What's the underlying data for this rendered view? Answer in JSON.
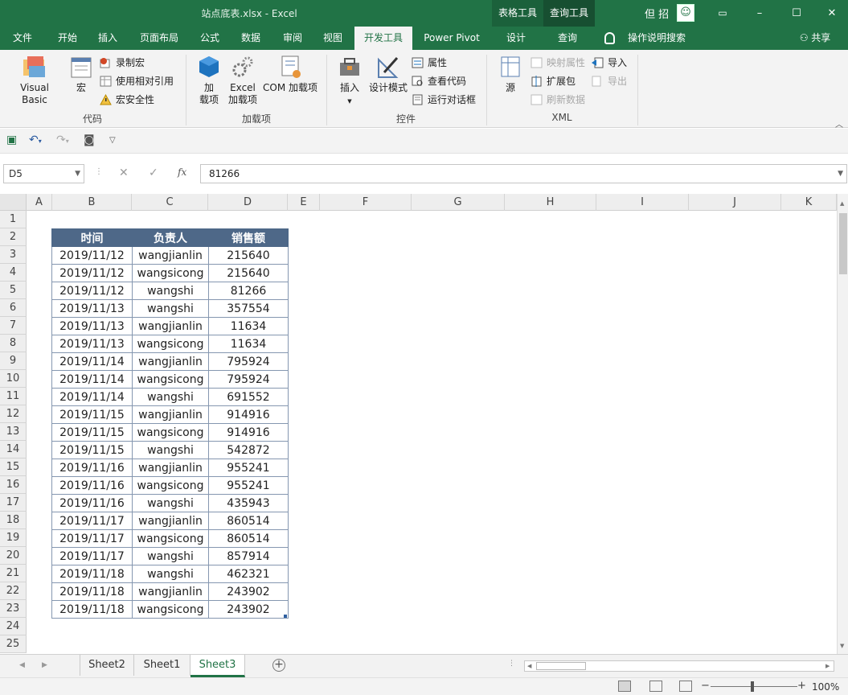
{
  "titlebar": {
    "title": "站点底表.xlsx - Excel",
    "context_tab_1": "表格工具",
    "context_tab_2": "查询工具",
    "user": "但 招",
    "avatar_icon": "user-avatar-icon",
    "ribbon_display_icon": "ribbon-display-options-icon",
    "minimize": "–",
    "maximize": "☐",
    "close": "✕"
  },
  "ribbon_tabs": [
    "文件",
    "开始",
    "插入",
    "页面布局",
    "公式",
    "数据",
    "审阅",
    "视图",
    "开发工具",
    "Power Pivot",
    "设计",
    "查询"
  ],
  "active_tab": "开发工具",
  "tell_me": "操作说明搜索",
  "share": "共享",
  "ribbon": {
    "code": {
      "label": "代码",
      "visual_basic": "Visual Basic",
      "macros": "宏",
      "record_macro": "录制宏",
      "relative_ref": "使用相对引用",
      "macro_security": "宏安全性"
    },
    "addins": {
      "label": "加载项",
      "addins_1": "加",
      "addins_2": "载项",
      "excel_addins_1": "Excel",
      "excel_addins_2": "加载项",
      "com_addins": "COM 加载项"
    },
    "controls": {
      "label": "控件",
      "insert": "插入",
      "design_mode": "设计模式",
      "properties": "属性",
      "view_code": "查看代码",
      "run_dialog": "运行对话框"
    },
    "xml": {
      "label": "XML",
      "source": "源",
      "map_props": "映射属性",
      "expansion_packs": "扩展包",
      "refresh_data": "刷新数据",
      "import": "导入",
      "export": "导出"
    }
  },
  "quick_access": {
    "save_icon": "save-icon",
    "undo_icon": "undo-icon",
    "redo_icon": "redo-icon",
    "camera_icon": "camera-icon",
    "customize_icon": "customize-qat-icon"
  },
  "formula_bar": {
    "name_box": "D5",
    "cancel": "✕",
    "enter": "✓",
    "fx": "fx",
    "value": "81266"
  },
  "columns": [
    "A",
    "B",
    "C",
    "D",
    "E",
    "F",
    "G",
    "H",
    "I",
    "J",
    "K"
  ],
  "rows": [
    "1",
    "2",
    "3",
    "4",
    "5",
    "6",
    "7",
    "8",
    "9",
    "10",
    "11",
    "12",
    "13",
    "14",
    "15",
    "16",
    "17",
    "18",
    "19",
    "20",
    "21",
    "22",
    "23",
    "24",
    "25"
  ],
  "table": {
    "headers": [
      "时间",
      "负责人",
      "销售额"
    ],
    "rows": [
      [
        "2019/11/12",
        "wangjianlin",
        "215640"
      ],
      [
        "2019/11/12",
        "wangsicong",
        "215640"
      ],
      [
        "2019/11/12",
        "wangshi",
        "81266"
      ],
      [
        "2019/11/13",
        "wangshi",
        "357554"
      ],
      [
        "2019/11/13",
        "wangjianlin",
        "11634"
      ],
      [
        "2019/11/13",
        "wangsicong",
        "11634"
      ],
      [
        "2019/11/14",
        "wangjianlin",
        "795924"
      ],
      [
        "2019/11/14",
        "wangsicong",
        "795924"
      ],
      [
        "2019/11/14",
        "wangshi",
        "691552"
      ],
      [
        "2019/11/15",
        "wangjianlin",
        "914916"
      ],
      [
        "2019/11/15",
        "wangsicong",
        "914916"
      ],
      [
        "2019/11/15",
        "wangshi",
        "542872"
      ],
      [
        "2019/11/16",
        "wangjianlin",
        "955241"
      ],
      [
        "2019/11/16",
        "wangsicong",
        "955241"
      ],
      [
        "2019/11/16",
        "wangshi",
        "435943"
      ],
      [
        "2019/11/17",
        "wangjianlin",
        "860514"
      ],
      [
        "2019/11/17",
        "wangsicong",
        "860514"
      ],
      [
        "2019/11/17",
        "wangshi",
        "857914"
      ],
      [
        "2019/11/18",
        "wangshi",
        "462321"
      ],
      [
        "2019/11/18",
        "wangjianlin",
        "243902"
      ],
      [
        "2019/11/18",
        "wangsicong",
        "243902"
      ]
    ]
  },
  "sheets": [
    "Sheet2",
    "Sheet1",
    "Sheet3"
  ],
  "active_sheet": "Sheet3",
  "status": {
    "zoom": "100%",
    "zoom_minus": "−",
    "zoom_plus": "+"
  },
  "colors": {
    "accent": "#217346",
    "table_header": "#4e6888"
  }
}
